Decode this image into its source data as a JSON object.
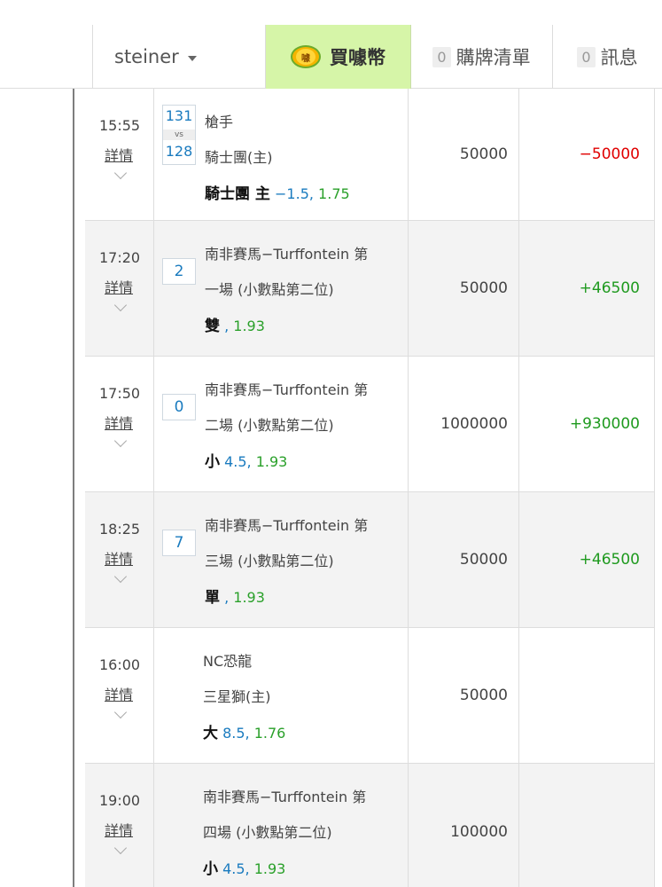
{
  "header": {
    "username": "steiner",
    "buy_label": "買噱幣",
    "coin_glyph": "噱",
    "cart": {
      "count": "0",
      "label": "購牌清單"
    },
    "messages": {
      "count": "0",
      "label": "訊息"
    }
  },
  "colors": {
    "accent_buy_bg": "#d6f5a8",
    "positive": "#1f9a1f",
    "negative": "#e00000",
    "link_blue": "#1a7bbf"
  },
  "rows": [
    {
      "time": "15:55",
      "details": "詳情",
      "badge_top": "131",
      "badge_mid": "vs",
      "badge_bottom": "128",
      "line1": "槍手",
      "line2": "騎士團(主)",
      "pick": "騎士團 主",
      "handicap": "−1.5,",
      "odds": "1.75",
      "stake": "50000",
      "result": "−50000"
    },
    {
      "time": "17:20",
      "details": "詳情",
      "badge": "2",
      "line1": "南非賽馬−Turffontein 第",
      "line2": "一場 (小數點第二位)",
      "pick": "雙",
      "handicap": ",",
      "odds": "1.93",
      "stake": "50000",
      "result": "+46500"
    },
    {
      "time": "17:50",
      "details": "詳情",
      "badge": "0",
      "line1": "南非賽馬−Turffontein 第",
      "line2": "二場 (小數點第二位)",
      "pick": "小",
      "handicap": "4.5,",
      "odds": "1.93",
      "stake": "1000000",
      "result": "+930000"
    },
    {
      "time": "18:25",
      "details": "詳情",
      "badge": "7",
      "line1": "南非賽馬−Turffontein 第",
      "line2": "三場 (小數點第二位)",
      "pick": "單",
      "handicap": ",",
      "odds": "1.93",
      "stake": "50000",
      "result": "+46500"
    },
    {
      "time": "16:00",
      "details": "詳情",
      "line1": "NC恐龍",
      "line2": "三星獅(主)",
      "pick": "大",
      "handicap": "8.5,",
      "odds": "1.76",
      "stake": "50000",
      "result": ""
    },
    {
      "time": "19:00",
      "details": "詳情",
      "line1": "南非賽馬−Turffontein 第",
      "line2": "四場 (小數點第二位)",
      "pick": "小",
      "handicap": "4.5,",
      "odds": "1.93",
      "stake": "100000",
      "result": ""
    }
  ]
}
